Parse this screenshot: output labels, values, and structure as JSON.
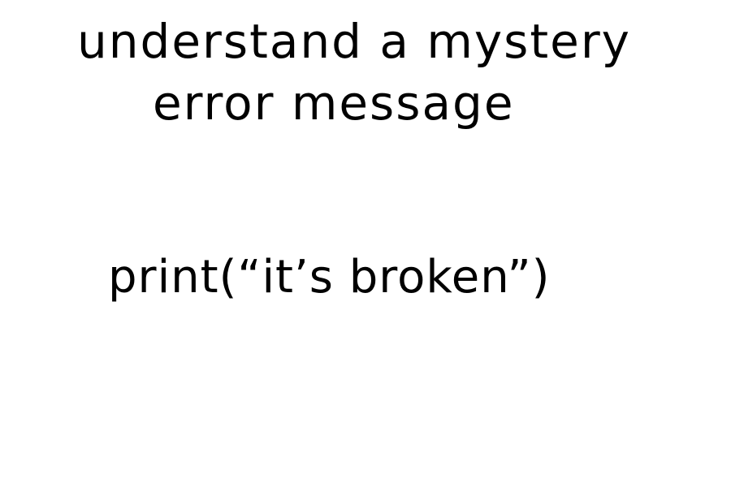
{
  "heading": {
    "line1": "understand a mystery",
    "line2": "error message"
  },
  "code": {
    "text": "print(“it’s broken”)"
  },
  "colors": {
    "background": "#ffffff",
    "ink": "#000000"
  }
}
